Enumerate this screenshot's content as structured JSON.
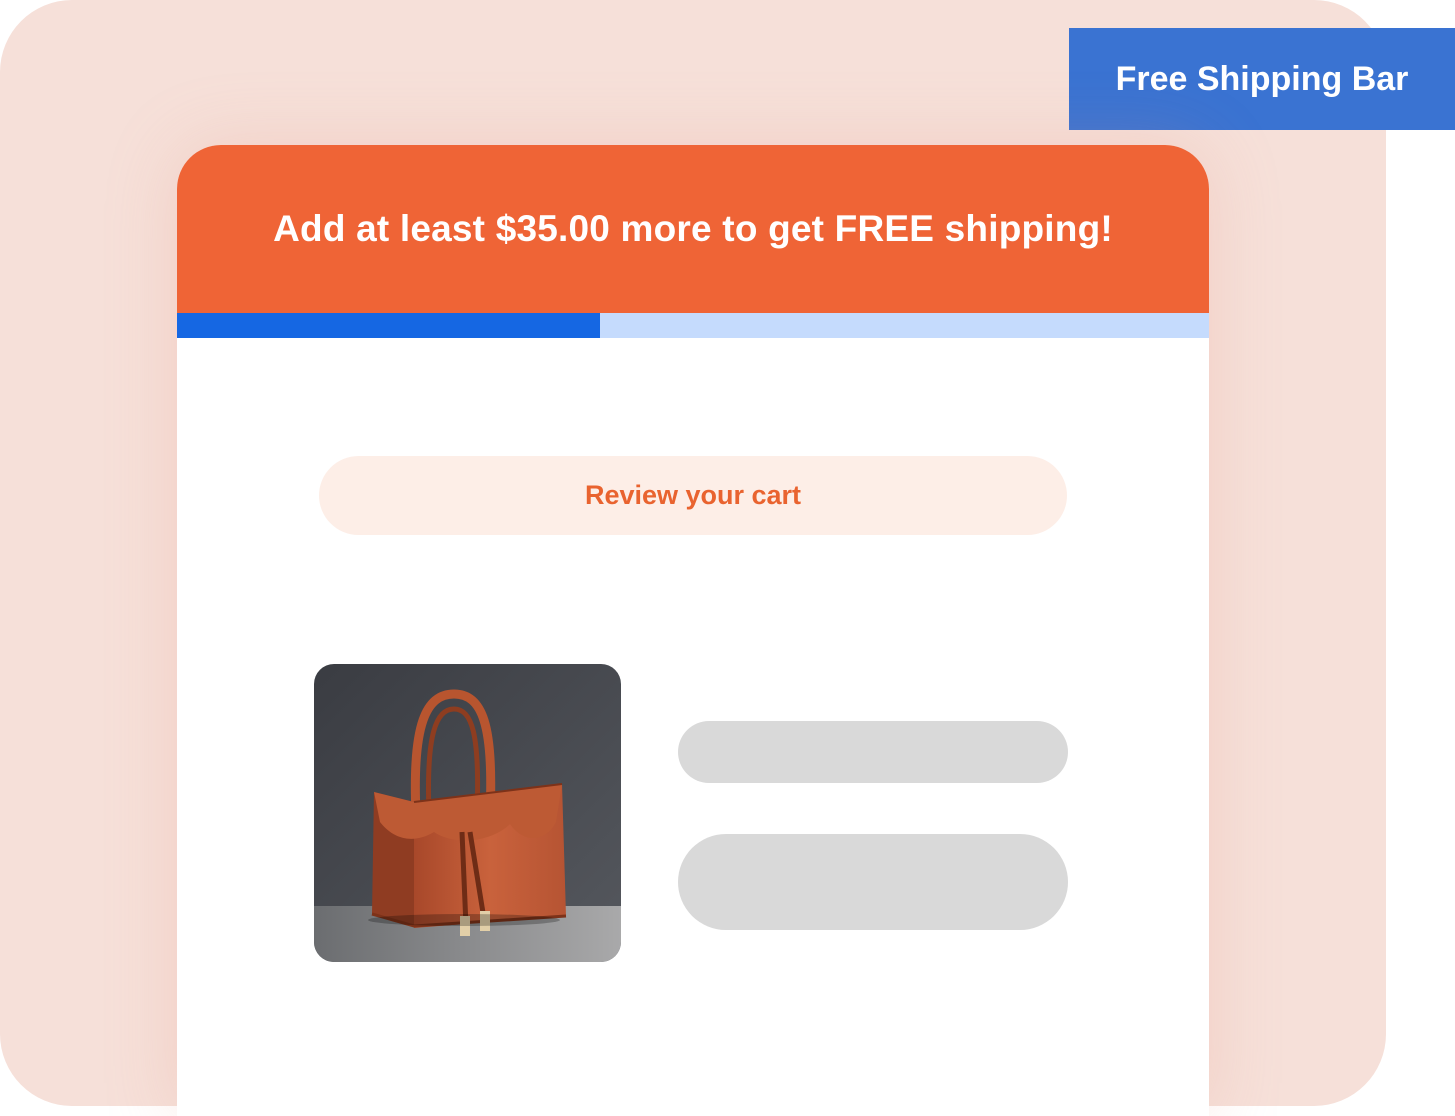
{
  "badge": {
    "label": "Free Shipping Bar"
  },
  "shipping_bar": {
    "message": "Add at least $35.00 more to get FREE shipping!",
    "progress": 0.41,
    "colors": {
      "header": "#ef6436",
      "progress_fill": "#1567e3",
      "progress_track": "#c5dbfd"
    }
  },
  "cart": {
    "review_label": "Review your cart",
    "product": {
      "image": "orange-leather-handbag"
    }
  }
}
